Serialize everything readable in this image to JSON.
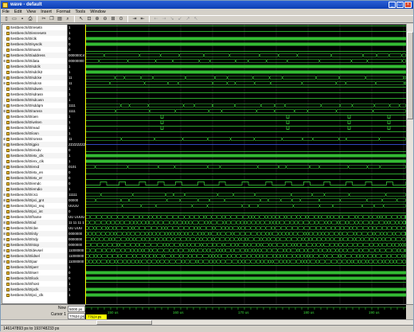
{
  "window": {
    "title": "wave - default"
  },
  "menu": [
    "File",
    "Edit",
    "View",
    "Insert",
    "Format",
    "Tools",
    "Window"
  ],
  "toolbar_icons": [
    "new-icon",
    "open-icon",
    "save-icon",
    "print-icon",
    "cut-icon",
    "copy-icon",
    "paste-icon",
    "find-icon",
    "pointer-icon",
    "zoom-mode-icon",
    "zoom-in-icon",
    "zoom-out-icon",
    "zoom-full-icon",
    "zoom-cursor-icon",
    "add-cursor-icon",
    "delete-cursor-icon",
    "prev-edge-icon",
    "next-edge-icon",
    "prev-fall-icon",
    "next-fall-icon",
    "prev-rise-icon",
    "next-rise-icon"
  ],
  "signals": [
    {
      "name": "/testbench/i0/resetn",
      "value": "1",
      "type": "bit",
      "color": "#3cdc3c"
    },
    {
      "name": "/testbench/i0/enresetn",
      "value": "1",
      "type": "bit",
      "color": "#3cdc3c"
    },
    {
      "name": "/testbench/i0/clk",
      "value": "0",
      "type": "clock",
      "color": "#3cdc3c"
    },
    {
      "name": "/testbench/i0/sysclk",
      "value": "0",
      "type": "clock",
      "color": "#3cdc3c"
    },
    {
      "name": "/testbench/i0/sextn",
      "value": "0",
      "type": "bit",
      "color": "#3cdc3c"
    },
    {
      "name": "/testbench/i0/address",
      "value": "000000C4",
      "type": "bus",
      "color": "#3cdc3c",
      "expand": true
    },
    {
      "name": "/testbench/i0/data",
      "value": "00000000",
      "type": "bus",
      "color": "#3cdc3c",
      "expand": true
    },
    {
      "name": "/testbench/i0/sdclk",
      "value": "1",
      "type": "clock",
      "color": "#3cdc3c"
    },
    {
      "name": "/testbench/i0/sdclk2",
      "value": "1",
      "type": "clock",
      "color": "#3cdc3c"
    },
    {
      "name": "/testbench/i0/sdcke",
      "value": "11",
      "type": "bus",
      "color": "#3cdc3c",
      "expand": true
    },
    {
      "name": "/testbench/i0/sdcsn",
      "value": "11",
      "type": "bus",
      "color": "#3cdc3c",
      "expand": true
    },
    {
      "name": "/testbench/i0/sdwen",
      "value": "1",
      "type": "bit",
      "color": "#3cdc3c"
    },
    {
      "name": "/testbench/i0/sdrasn",
      "value": "1",
      "type": "bit",
      "color": "#3cdc3c"
    },
    {
      "name": "/testbench/i0/sdcasn",
      "value": "1",
      "type": "bit",
      "color": "#3cdc3c"
    },
    {
      "name": "/testbench/i0/sddqm",
      "value": "1111",
      "type": "bus",
      "color": "#3cdc3c",
      "expand": true
    },
    {
      "name": "/testbench/i0/ramsn",
      "value": "1111",
      "type": "bus",
      "color": "#3cdc3c",
      "expand": true
    },
    {
      "name": "/testbench/i0/oen",
      "value": "1",
      "type": "bit",
      "color": "#3cdc3c"
    },
    {
      "name": "/testbench/i0/writen",
      "value": "1",
      "type": "bit",
      "color": "#3cdc3c"
    },
    {
      "name": "/testbench/i0/read",
      "value": "1",
      "type": "bit",
      "color": "#3cdc3c"
    },
    {
      "name": "/testbench/i0/iosn",
      "value": "1",
      "type": "bit",
      "color": "#3cdc3c"
    },
    {
      "name": "/testbench/i0/romsn",
      "value": "11",
      "type": "bus",
      "color": "#3cdc3c",
      "expand": true
    },
    {
      "name": "/testbench/i0/gpio",
      "value": "ZZZZZZZZ",
      "type": "z",
      "color": "#4060ff",
      "expand": true
    },
    {
      "name": "/testbench/i0/erxdv",
      "value": "0",
      "type": "bit",
      "color": "#3cdc3c"
    },
    {
      "name": "/testbench/i0/etx_clk",
      "value": "1",
      "type": "fastclock",
      "color": "#3cdc3c"
    },
    {
      "name": "/testbench/i0/erx_clk",
      "value": "1",
      "type": "fastclock",
      "color": "#3cdc3c"
    },
    {
      "name": "/testbench/i0/erxd",
      "value": "0101",
      "type": "bus",
      "color": "#3cdc3c",
      "expand": true
    },
    {
      "name": "/testbench/i0/etx_en",
      "value": "0",
      "type": "bit",
      "color": "#3cdc3c"
    },
    {
      "name": "/testbench/i0/etx_er",
      "value": "0",
      "type": "bit",
      "color": "#3cdc3c"
    },
    {
      "name": "/testbench/i0/emdc",
      "value": "0",
      "type": "pulse",
      "color": "#3cdc3c"
    },
    {
      "name": "/testbench/i0/emdio",
      "value": "1",
      "type": "bit",
      "color": "#3cdc3c"
    },
    {
      "name": "/testbench/i0/cs1",
      "value": "11111",
      "type": "bus",
      "color": "#3cdc3c",
      "expand": true
    },
    {
      "name": "/testbench/i0/pci_gnt",
      "value": "00000",
      "type": "bus",
      "color": "#3cdc3c",
      "expand": true
    },
    {
      "name": "/testbench/i0/pci_req",
      "value": "UUUU",
      "type": "bus",
      "color": "#3cdc3c",
      "expand": true
    },
    {
      "name": "/testbench/i0/pci_int",
      "value": "0",
      "type": "bit",
      "color": "#3cdc3c"
    },
    {
      "name": "/testbench/i0/frame",
      "value": "UU UUUU",
      "type": "busdense",
      "color": "#3cdc3c",
      "expand": true
    },
    {
      "name": "/testbench/i0/ad",
      "value": "11 11 11 1",
      "type": "busdense",
      "color": "#3cdc3c",
      "expand": true
    },
    {
      "name": "/testbench/i0/cbe",
      "value": "UU UUU",
      "type": "busdense",
      "color": "#3cdc3c",
      "expand": true
    },
    {
      "name": "/testbench/i0/irdy",
      "value": "0000000",
      "type": "busdense",
      "color": "#3cdc3c",
      "expand": true
    },
    {
      "name": "/testbench/i0/trdy",
      "value": "0000000",
      "type": "busdense",
      "color": "#3cdc3c",
      "expand": true
    },
    {
      "name": "/testbench/i0/stop",
      "value": "0000000",
      "type": "busdense",
      "color": "#3cdc3c",
      "expand": true
    },
    {
      "name": "/testbench/i0/devsel",
      "value": "11000000",
      "type": "busdense",
      "color": "#3cdc3c",
      "expand": true
    },
    {
      "name": "/testbench/i0/idsel",
      "value": "11000000",
      "type": "busdense",
      "color": "#3cdc3c",
      "expand": true
    },
    {
      "name": "/testbench/i0/par",
      "value": "11000000",
      "type": "busdense",
      "color": "#3cdc3c",
      "expand": true
    },
    {
      "name": "/testbench/i0/perr",
      "value": "1",
      "type": "bit",
      "color": "#3cdc3c"
    },
    {
      "name": "/testbench/i0/serr",
      "value": "0",
      "type": "clock",
      "color": "#3cdc3c"
    },
    {
      "name": "/testbench/i0/lock",
      "value": "0",
      "type": "clock",
      "color": "#3cdc3c"
    },
    {
      "name": "/testbench/i0/host",
      "value": "1",
      "type": "bit",
      "color": "#3cdc3c"
    },
    {
      "name": "/testbench/i0/pclk",
      "value": "1",
      "type": "clock",
      "color": "#3cdc3c"
    },
    {
      "name": "/testbench/i0/pci_clk",
      "value": "1",
      "type": "clock",
      "color": "#3cdc3c"
    }
  ],
  "cursor_bar": {
    "now_label": "Now",
    "now_value": "5000 ps",
    "cursor_label": "Cursor 1",
    "cursor_value": "77624 ps"
  },
  "timeline": {
    "ticks": [
      "150 us",
      "160 us",
      "170 us",
      "180 us",
      "190 us"
    ],
    "cursor_value": "77624 ps"
  },
  "status": {
    "text": "146147893 ps to 193748233 ps"
  },
  "colors": {
    "wave": "#3cdc3c",
    "z": "#4060ff",
    "cursor": "#ffff00",
    "grid": "#303030"
  }
}
